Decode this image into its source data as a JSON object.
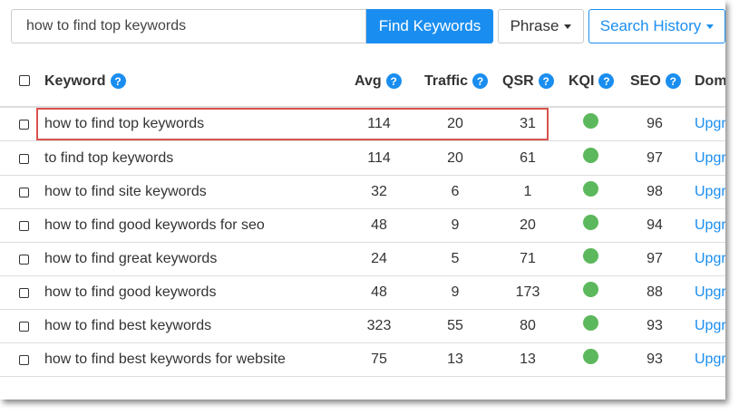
{
  "search": {
    "value": "how to find top keywords",
    "find_label": "Find Keywords",
    "phrase_label": "Phrase",
    "history_label": "Search History"
  },
  "columns": {
    "keyword": "Keyword",
    "avg": "Avg",
    "traffic": "Traffic",
    "qsr": "QSR",
    "kqi": "KQI",
    "seo": "SEO",
    "domain": "Dom"
  },
  "help_glyph": "?",
  "rows": [
    {
      "keyword": "how to find top keywords",
      "avg": "114",
      "traffic": "20",
      "qsr": "31",
      "kqi": "green",
      "seo": "96",
      "domain": "Upgr"
    },
    {
      "keyword": "to find top keywords",
      "avg": "114",
      "traffic": "20",
      "qsr": "61",
      "kqi": "green",
      "seo": "97",
      "domain": "Upgr"
    },
    {
      "keyword": "how to find site keywords",
      "avg": "32",
      "traffic": "6",
      "qsr": "1",
      "kqi": "green",
      "seo": "98",
      "domain": "Upgr"
    },
    {
      "keyword": "how to find good keywords for seo",
      "avg": "48",
      "traffic": "9",
      "qsr": "20",
      "kqi": "green",
      "seo": "94",
      "domain": "Upgr"
    },
    {
      "keyword": "how to find great keywords",
      "avg": "24",
      "traffic": "5",
      "qsr": "71",
      "kqi": "green",
      "seo": "97",
      "domain": "Upgr"
    },
    {
      "keyword": "how to find good keywords",
      "avg": "48",
      "traffic": "9",
      "qsr": "173",
      "kqi": "green",
      "seo": "88",
      "domain": "Upgr"
    },
    {
      "keyword": "how to find best keywords",
      "avg": "323",
      "traffic": "55",
      "qsr": "80",
      "kqi": "green",
      "seo": "93",
      "domain": "Upgr"
    },
    {
      "keyword": "how to find best keywords for website",
      "avg": "75",
      "traffic": "13",
      "qsr": "13",
      "kqi": "green",
      "seo": "93",
      "domain": "Upgr"
    }
  ],
  "colors": {
    "accent": "#1a8ef0",
    "kqi_green": "#5cb85c",
    "highlight_border": "#d9534f"
  },
  "icons": {
    "help": "question-circle-icon",
    "dropdown": "caret-down-icon",
    "kqi": "status-dot-icon"
  }
}
